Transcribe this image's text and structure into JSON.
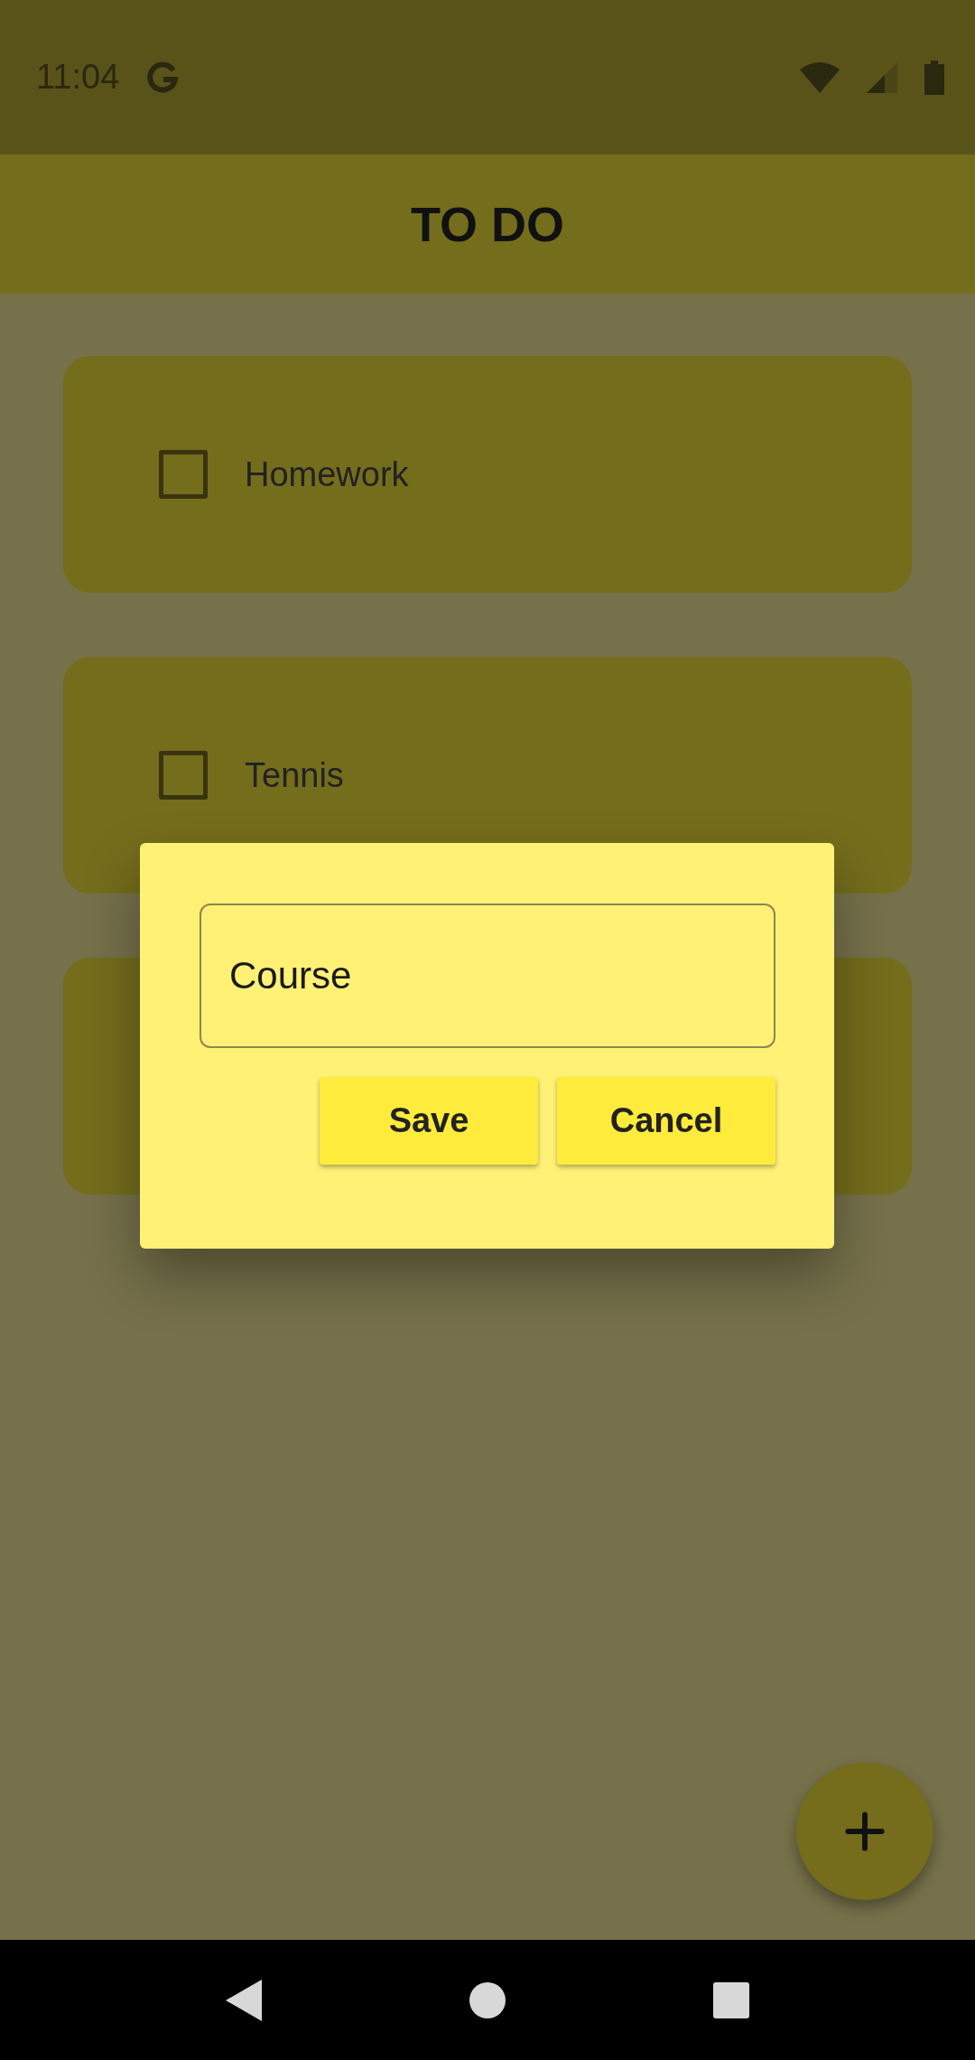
{
  "status_bar": {
    "time": "11:04"
  },
  "app_bar": {
    "title": "TO DO"
  },
  "tasks": [
    {
      "label": "Homework",
      "checked": false
    },
    {
      "label": "Tennis",
      "checked": false
    }
  ],
  "dialog": {
    "field": {
      "value": "Course"
    },
    "buttons": [
      "Save",
      "Cancel"
    ]
  }
}
